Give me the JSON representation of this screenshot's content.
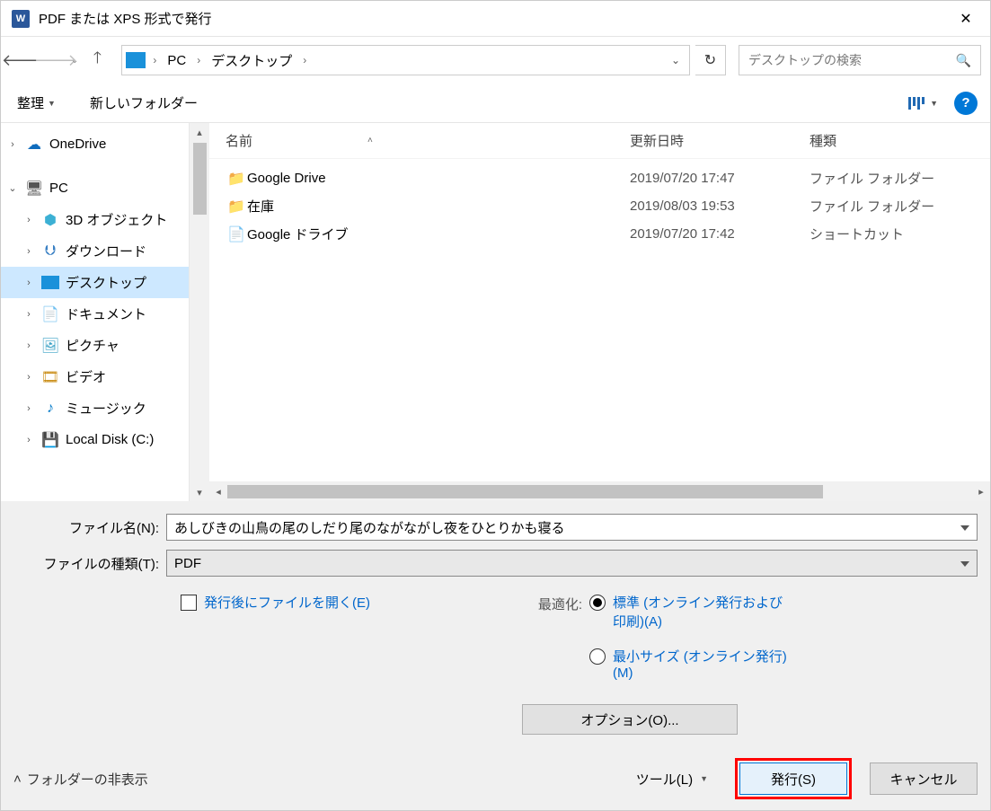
{
  "titlebar": {
    "app_icon_text": "W",
    "title": "PDF または XPS 形式で発行"
  },
  "nav": {
    "breadcrumb": [
      "PC",
      "デスクトップ"
    ],
    "search_placeholder": "デスクトップの検索"
  },
  "toolbar": {
    "organize": "整理",
    "new_folder": "新しいフォルダー"
  },
  "sidebar": {
    "items": [
      {
        "label": "OneDrive",
        "level": 1,
        "caret": ">",
        "icon": "onedrive"
      },
      {
        "label": "PC",
        "level": 1,
        "caret": "v",
        "icon": "pc"
      },
      {
        "label": "3D オブジェクト",
        "level": 2,
        "caret": ">",
        "icon": "3d"
      },
      {
        "label": "ダウンロード",
        "level": 2,
        "caret": ">",
        "icon": "download"
      },
      {
        "label": "デスクトップ",
        "level": 2,
        "caret": ">",
        "icon": "desktop",
        "selected": true
      },
      {
        "label": "ドキュメント",
        "level": 2,
        "caret": ">",
        "icon": "doc"
      },
      {
        "label": "ピクチャ",
        "level": 2,
        "caret": ">",
        "icon": "pic"
      },
      {
        "label": "ビデオ",
        "level": 2,
        "caret": ">",
        "icon": "video"
      },
      {
        "label": "ミュージック",
        "level": 2,
        "caret": ">",
        "icon": "music"
      },
      {
        "label": "Local Disk (C:)",
        "level": 2,
        "caret": ">",
        "icon": "disk"
      }
    ]
  },
  "columns": {
    "name": "名前",
    "date": "更新日時",
    "type": "種類"
  },
  "files": [
    {
      "name": "Google Drive",
      "date": "2019/07/20 17:47",
      "type": "ファイル フォルダー",
      "icon": "folder"
    },
    {
      "name": "在庫",
      "date": "2019/08/03 19:53",
      "type": "ファイル フォルダー",
      "icon": "folder"
    },
    {
      "name": "Google ドライブ",
      "date": "2019/07/20 17:42",
      "type": "ショートカット",
      "icon": "shortcut"
    }
  ],
  "form": {
    "filename_label": "ファイル名(N):",
    "filename_value": "あしびきの山鳥の尾のしだり尾のながながし夜をひとりかも寝る",
    "filetype_label": "ファイルの種類(T):",
    "filetype_value": "PDF",
    "open_after_label": "発行後にファイルを開く(E)",
    "optimize_label": "最適化:",
    "radio_standard": "標準 (オンライン発行および印刷)(A)",
    "radio_min": "最小サイズ (オンライン発行)(M)",
    "options_btn": "オプション(O)..."
  },
  "footer": {
    "hide_folders": "フォルダーの非表示",
    "tools": "ツール(L)",
    "publish": "発行(S)",
    "cancel": "キャンセル"
  }
}
